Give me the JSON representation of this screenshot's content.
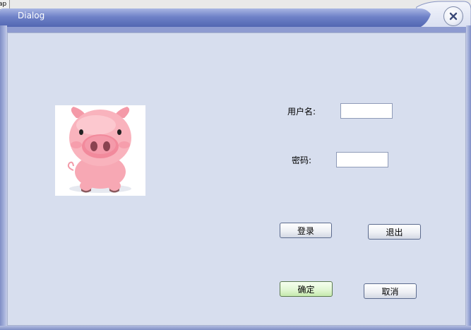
{
  "background": {
    "tab_label": "ap"
  },
  "dialog": {
    "title": "Dialog",
    "close_icon": "close-icon",
    "colors": {
      "title_bar": "#5a6fb8",
      "client_bg": "#d7deee",
      "default_button": "#d4f3c0"
    }
  },
  "form": {
    "username_label": "用户名:",
    "username_value": "",
    "password_label": "密码:",
    "password_value": ""
  },
  "buttons": {
    "login": "登录",
    "exit": "退出",
    "ok": "确定",
    "cancel": "取消"
  },
  "image": {
    "icon": "pig-image"
  }
}
